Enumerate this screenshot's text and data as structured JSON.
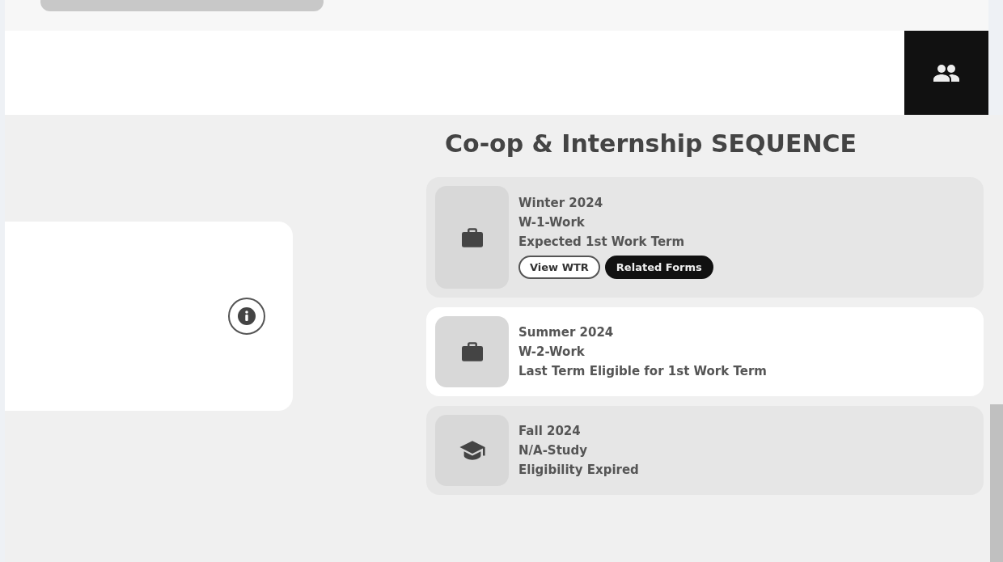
{
  "sequence": {
    "title": "Co-op & Internship SEQUENCE",
    "terms": [
      {
        "kind": "work",
        "term": "Winter 2024",
        "code": "W-1-Work",
        "status": "Expected 1st Work Term",
        "selected": false,
        "buttons": [
          {
            "kind": "outline",
            "label": "View WTR"
          },
          {
            "kind": "filled",
            "label": "Related Forms"
          }
        ]
      },
      {
        "kind": "work",
        "term": "Summer 2024",
        "code": "W-2-Work",
        "status": "Last Term Eligible for 1st Work Term",
        "selected": true
      },
      {
        "kind": "study",
        "term": "Fall 2024",
        "code": "N/A-Study",
        "status": "Eligibility Expired",
        "selected": false
      }
    ]
  }
}
